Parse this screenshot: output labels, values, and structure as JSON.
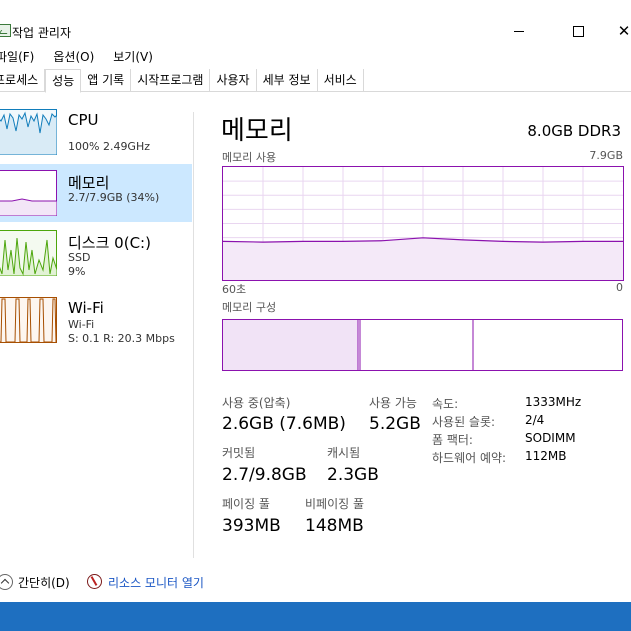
{
  "window": {
    "title": "작업 관리자"
  },
  "menu": [
    "파일(F)",
    "옵션(O)",
    "보기(V)"
  ],
  "tabs": [
    "프로세스",
    "성능",
    "앱 기록",
    "시작프로그램",
    "사용자",
    "세부 정보",
    "서비스"
  ],
  "active_tab": "성능",
  "sidebar": {
    "items": [
      {
        "title": "CPU",
        "sub1": "100% 2.49GHz",
        "sub2": "",
        "color": "#117dbb"
      },
      {
        "title": "메모리",
        "sub1": "2.7/7.9GB (34%)",
        "sub2": "",
        "color": "#8b12ae"
      },
      {
        "title": "디스크 0(C:)",
        "sub1": "SSD",
        "sub2": "9%",
        "color": "#4da60c"
      },
      {
        "title": "Wi-Fi",
        "sub1": "Wi-Fi",
        "sub2": "S: 0.1  R: 20.3 Mbps",
        "color": "#a74f01"
      }
    ]
  },
  "main": {
    "title": "메모리",
    "spec": "8.0GB DDR3",
    "usage_label": "메모리 사용",
    "usage_max": "7.9GB",
    "time_left": "60초",
    "time_right": "0",
    "composition_label": "메모리 구성"
  },
  "stats": {
    "in_use_label": "사용 중(압축)",
    "in_use_value": "2.6GB (7.6MB)",
    "available_label": "사용 가능",
    "available_value": "5.2GB",
    "committed_label": "커밋됨",
    "committed_value": "2.7/9.8GB",
    "cached_label": "캐시됨",
    "cached_value": "2.3GB",
    "paged_label": "페이징 풀",
    "paged_value": "393MB",
    "nonpaged_label": "비페이징 풀",
    "nonpaged_value": "148MB"
  },
  "details": [
    {
      "key": "속도:",
      "value": "1333MHz"
    },
    {
      "key": "사용된 슬롯:",
      "value": "2/4"
    },
    {
      "key": "폼 팩터:",
      "value": "SODIMM"
    },
    {
      "key": "하드웨어 예약:",
      "value": "112MB"
    }
  ],
  "footer": {
    "fewer_details": "간단히(D)",
    "resource_monitor": "리소스 모니터 열기"
  },
  "chart_data": {
    "type": "area",
    "title": "메모리 사용",
    "x": [
      60,
      54,
      48,
      42,
      36,
      30,
      24,
      18,
      12,
      6,
      0
    ],
    "series": [
      {
        "values": [
          2.7,
          2.65,
          2.7,
          2.7,
          2.75,
          2.95,
          2.8,
          2.7,
          2.65,
          2.7,
          2.7
        ]
      }
    ],
    "ylim": [
      0,
      7.9
    ],
    "grid": true,
    "color": "#8b12ae"
  }
}
